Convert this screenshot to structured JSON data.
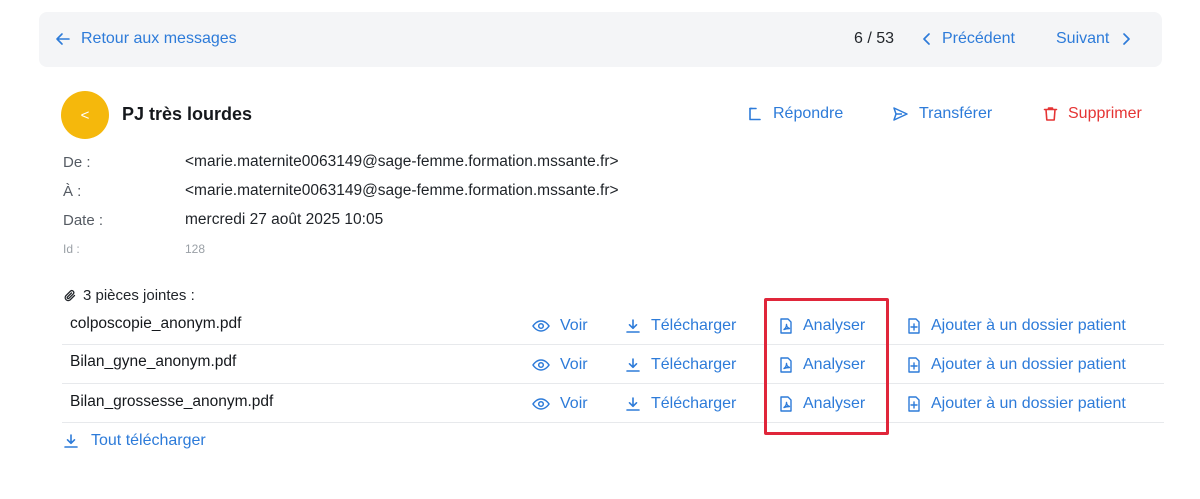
{
  "topbar": {
    "back_label": "Retour aux messages",
    "pager_count": "6 / 53",
    "prev_label": "Précédent",
    "next_label": "Suivant"
  },
  "message": {
    "avatar_glyph": "<",
    "subject": "PJ très lourdes",
    "actions": {
      "reply": "Répondre",
      "forward": "Transférer",
      "delete": "Supprimer"
    },
    "meta": {
      "from_label": "De :",
      "from_value": "<marie.maternite0063149@sage-femme.formation.mssante.fr>",
      "to_label": "À :",
      "to_value": "<marie.maternite0063149@sage-femme.formation.mssante.fr>",
      "date_label": "Date :",
      "date_value": "mercredi 27 août 2025 10:05",
      "id_label": "Id :",
      "id_value": "128"
    }
  },
  "attachments": {
    "header": "3 pièces jointes :",
    "items": [
      {
        "name": "colposcopie_anonym.pdf"
      },
      {
        "name": "Bilan_gyne_anonym.pdf"
      },
      {
        "name": "Bilan_grossesse_anonym.pdf"
      }
    ],
    "buttons": {
      "view": "Voir",
      "download": "Télécharger",
      "analyze": "Analyser",
      "add_to_patient": "Ajouter à un dossier patient"
    },
    "download_all": "Tout télécharger"
  },
  "colors": {
    "accent": "#2d7bd9",
    "danger": "#e53434",
    "avatar": "#f5b80c",
    "highlight": "#e0263a"
  },
  "icons": {
    "back": "arrow-left-icon",
    "prev": "chevron-left-icon",
    "next": "chevron-right-icon",
    "reply": "reply-icon",
    "forward": "send-icon",
    "delete": "trash-icon",
    "attachment": "paperclip-icon",
    "view": "eye-icon",
    "download": "download-icon",
    "analyze": "pdf-file-icon",
    "add": "file-plus-icon"
  }
}
